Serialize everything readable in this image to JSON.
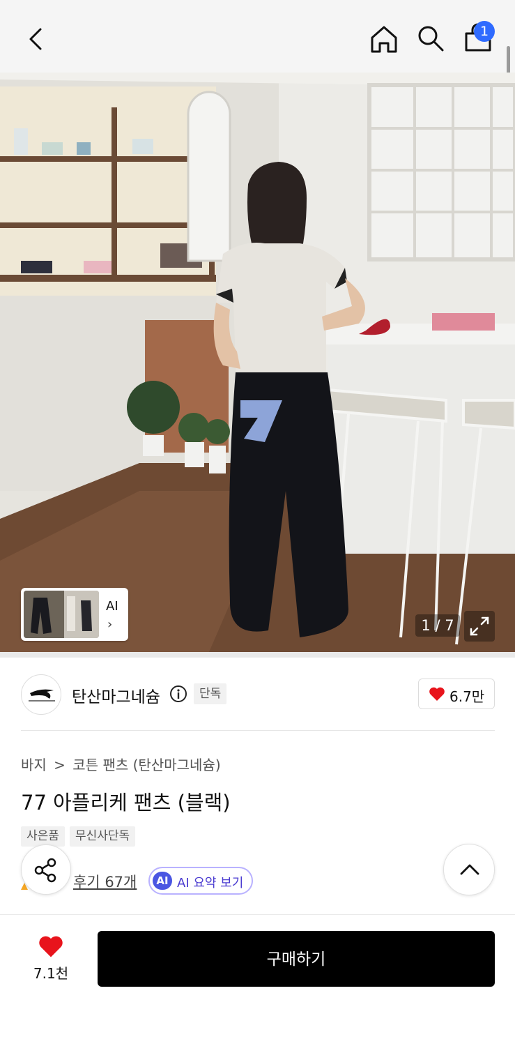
{
  "header": {
    "back_icon": "back-chevron-icon",
    "home_icon": "home-icon",
    "search_icon": "search-icon",
    "cart_icon": "shopping-bag-icon",
    "cart_count": "1"
  },
  "gallery": {
    "ai_thumb_label": "AI",
    "ai_thumb_chevron": "›",
    "counter": "1 / 7",
    "current_index": 1,
    "total": 7,
    "expand_icon": "expand-icon"
  },
  "brand": {
    "name": "탄산마그네슘",
    "info_icon": "info-icon",
    "badge": "단독",
    "likes": "6.7만",
    "logo_text": "tansanmagnesium"
  },
  "product": {
    "breadcrumb": [
      "바지",
      "코튼 팬츠 (탄산마그네슘)"
    ],
    "breadcrumb_separator": ">",
    "title": "77 아플리케 팬츠 (블랙)",
    "tags": [
      "사은품",
      "무신사단독"
    ],
    "reviews_link": "후기 67개",
    "ai_summary_badge": "AI",
    "ai_summary_label": "AI 요약 보기"
  },
  "bottom_bar": {
    "favorite_count": "7.1천",
    "buy_label": "구매하기"
  },
  "colors": {
    "accent_blue": "#2f6bff",
    "heart_red": "#e8141c",
    "ai_purple": "#4a56e2",
    "buy_bg": "#000000"
  }
}
